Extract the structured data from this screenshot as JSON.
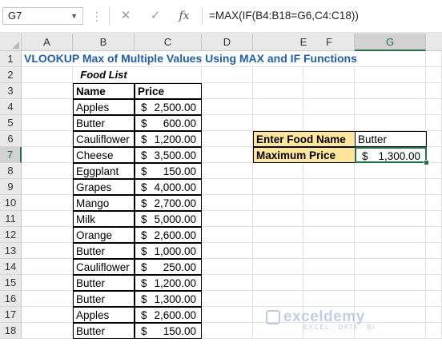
{
  "formula_bar": {
    "name_box": "G7",
    "dots": "⋮",
    "cancel_glyph": "✕",
    "enter_glyph": "✓",
    "fx_label": "fx",
    "formula": "=MAX(IF(B4:B18=G6,C4:C18))"
  },
  "columns": [
    "A",
    "B",
    "C",
    "D",
    "E",
    "F",
    "G"
  ],
  "rows": [
    "1",
    "2",
    "3",
    "4",
    "5",
    "6",
    "7",
    "8",
    "9",
    "10",
    "11",
    "12",
    "13",
    "14",
    "15",
    "16",
    "17",
    "18"
  ],
  "sheet": {
    "title": "VLOOKUP Max of Multiple Values Using MAX and IF Functions",
    "subtitle": "Food List",
    "headers": {
      "name": "Name",
      "price": "Price"
    },
    "currency": "$",
    "items": [
      {
        "name": "Apples",
        "price": "2,500.00"
      },
      {
        "name": "Butter",
        "price": "600.00"
      },
      {
        "name": "Cauliflower",
        "price": "1,200.00"
      },
      {
        "name": "Cheese",
        "price": "3,500.00"
      },
      {
        "name": "Eggplant",
        "price": "150.00"
      },
      {
        "name": "Grapes",
        "price": "4,000.00"
      },
      {
        "name": "Mango",
        "price": "2,700.00"
      },
      {
        "name": "Milk",
        "price": "5,000.00"
      },
      {
        "name": "Orange",
        "price": "2,600.00"
      },
      {
        "name": "Butter",
        "price": "1,000.00"
      },
      {
        "name": "Cauliflower",
        "price": "250.00"
      },
      {
        "name": "Butter",
        "price": "1,200.00"
      },
      {
        "name": "Butter",
        "price": "1,300.00"
      },
      {
        "name": "Apples",
        "price": "2,600.00"
      },
      {
        "name": "Butter",
        "price": "150.00"
      }
    ],
    "lookup": {
      "food_label": "Enter Food Name",
      "food_value": "Butter",
      "max_label": "Maximum Price",
      "max_value": "1,300.00"
    }
  },
  "watermark": {
    "brand": "exceldemy",
    "tagline": "EXCEL · DATA · BI"
  },
  "colors": {
    "accent": "#217346",
    "title": "#1f5fb0",
    "label_fill": "#ffe699"
  }
}
